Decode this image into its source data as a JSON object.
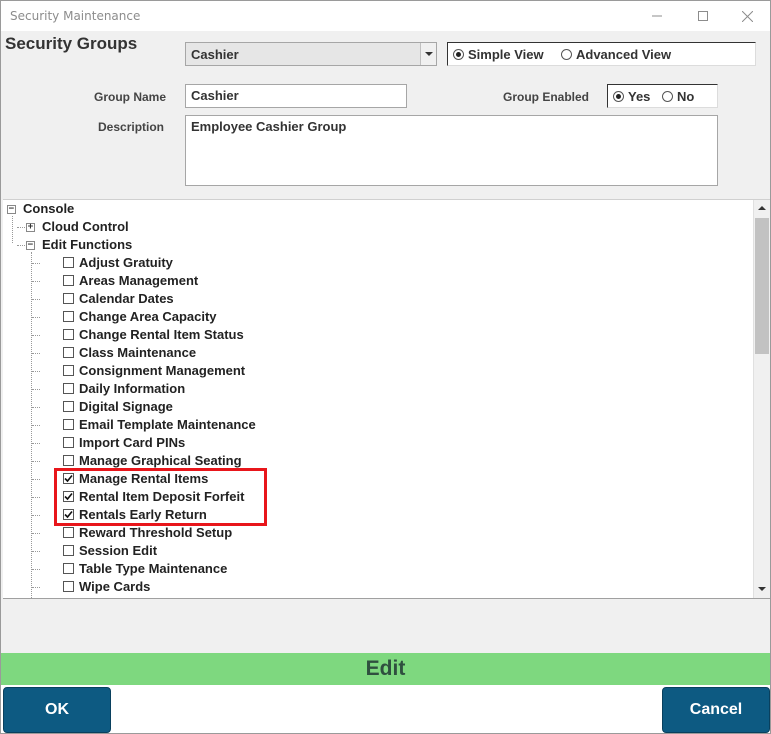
{
  "window": {
    "title": "Security Maintenance"
  },
  "header": {
    "section_title": "Security Groups",
    "group_select_value": "Cashier",
    "view_options": [
      "Simple View",
      "Advanced View"
    ],
    "view_selected": "Simple View"
  },
  "form": {
    "group_name_label": "Group Name",
    "group_name_value": "Cashier",
    "group_enabled_label": "Group Enabled",
    "enabled_options": [
      "Yes",
      "No"
    ],
    "enabled_selected": "Yes",
    "description_label": "Description",
    "description_value": "Employee Cashier Group"
  },
  "tree": {
    "root": {
      "label": "Console",
      "expanded": true
    },
    "nodes": [
      {
        "label": "Cloud Control",
        "expanded": false
      },
      {
        "label": "Edit Functions",
        "expanded": true
      }
    ],
    "edit_functions": [
      {
        "label": "Adjust Gratuity",
        "checked": false
      },
      {
        "label": "Areas Management",
        "checked": false
      },
      {
        "label": "Calendar Dates",
        "checked": false
      },
      {
        "label": "Change Area Capacity",
        "checked": false
      },
      {
        "label": "Change Rental Item Status",
        "checked": false
      },
      {
        "label": "Class Maintenance",
        "checked": false
      },
      {
        "label": "Consignment Management",
        "checked": false
      },
      {
        "label": "Daily Information",
        "checked": false
      },
      {
        "label": "Digital Signage",
        "checked": false
      },
      {
        "label": "Email Template Maintenance",
        "checked": false
      },
      {
        "label": "Import Card PINs",
        "checked": false
      },
      {
        "label": "Manage Graphical Seating",
        "checked": false
      },
      {
        "label": "Manage Rental Items",
        "checked": true
      },
      {
        "label": "Rental Item Deposit Forfeit",
        "checked": true
      },
      {
        "label": "Rentals Early Return",
        "checked": true
      },
      {
        "label": "Reward Threshold Setup",
        "checked": false
      },
      {
        "label": "Session Edit",
        "checked": false
      },
      {
        "label": "Table Type Maintenance",
        "checked": false
      },
      {
        "label": "Wipe Cards",
        "checked": false
      }
    ]
  },
  "footer": {
    "mode_label": "Edit",
    "ok_label": "OK",
    "cancel_label": "Cancel"
  },
  "colors": {
    "edit_bar": "#7ed87f",
    "button": "#0d5a82",
    "highlight": "#e8161b"
  }
}
